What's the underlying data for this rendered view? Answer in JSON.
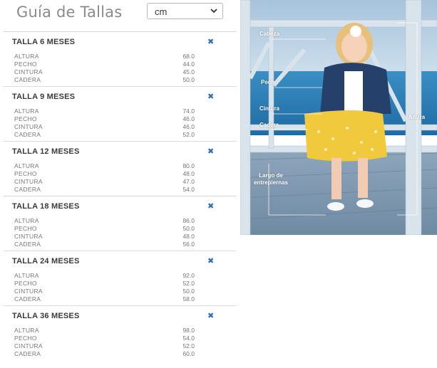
{
  "header": {
    "title": "Guía de Tallas",
    "unit_selected": "cm"
  },
  "sizes": [
    {
      "title": "TALLA 6 MESES",
      "rows": [
        {
          "label": "ALTURA",
          "value": "68.0"
        },
        {
          "label": "PECHO",
          "value": "44.0"
        },
        {
          "label": "CINTURA",
          "value": "45.0"
        },
        {
          "label": "CADERA",
          "value": "50.0"
        }
      ]
    },
    {
      "title": "TALLA 9 MESES",
      "rows": [
        {
          "label": "ALTURA",
          "value": "74.0"
        },
        {
          "label": "PECHO",
          "value": "46.0"
        },
        {
          "label": "CINTURA",
          "value": "46.0"
        },
        {
          "label": "CADERA",
          "value": "52.0"
        }
      ]
    },
    {
      "title": "TALLA 12 MESES",
      "rows": [
        {
          "label": "ALTURA",
          "value": "80.0"
        },
        {
          "label": "PECHO",
          "value": "48.0"
        },
        {
          "label": "CINTURA",
          "value": "47.0"
        },
        {
          "label": "CADERA",
          "value": "54.0"
        }
      ]
    },
    {
      "title": "TALLA 18 MESES",
      "rows": [
        {
          "label": "ALTURA",
          "value": "86.0"
        },
        {
          "label": "PECHO",
          "value": "50.0"
        },
        {
          "label": "CINTURA",
          "value": "48.0"
        },
        {
          "label": "CADERA",
          "value": "56.0"
        }
      ]
    },
    {
      "title": "TALLA 24 MESES",
      "rows": [
        {
          "label": "ALTURA",
          "value": "92.0"
        },
        {
          "label": "PECHO",
          "value": "52.0"
        },
        {
          "label": "CINTURA",
          "value": "50.0"
        },
        {
          "label": "CADERA",
          "value": "58.0"
        }
      ]
    },
    {
      "title": "TALLA 36 MESES",
      "rows": [
        {
          "label": "ALTURA",
          "value": "98.0"
        },
        {
          "label": "PECHO",
          "value": "54.0"
        },
        {
          "label": "CINTURA",
          "value": "52.0"
        },
        {
          "label": "CADERA",
          "value": "60.0"
        }
      ]
    }
  ],
  "close_icon": "close-x-icon",
  "photo": {
    "labels": {
      "cabeza": "Cabeza",
      "pecho": "Pecho",
      "cintura": "Cintura",
      "cadera": "Cadera",
      "altura": "Altura",
      "largo": "Largo de entrepiernas"
    }
  },
  "colors": {
    "accent": "#2a6fb8",
    "title": "#8b8b8b",
    "divider": "#d9d9d9"
  }
}
